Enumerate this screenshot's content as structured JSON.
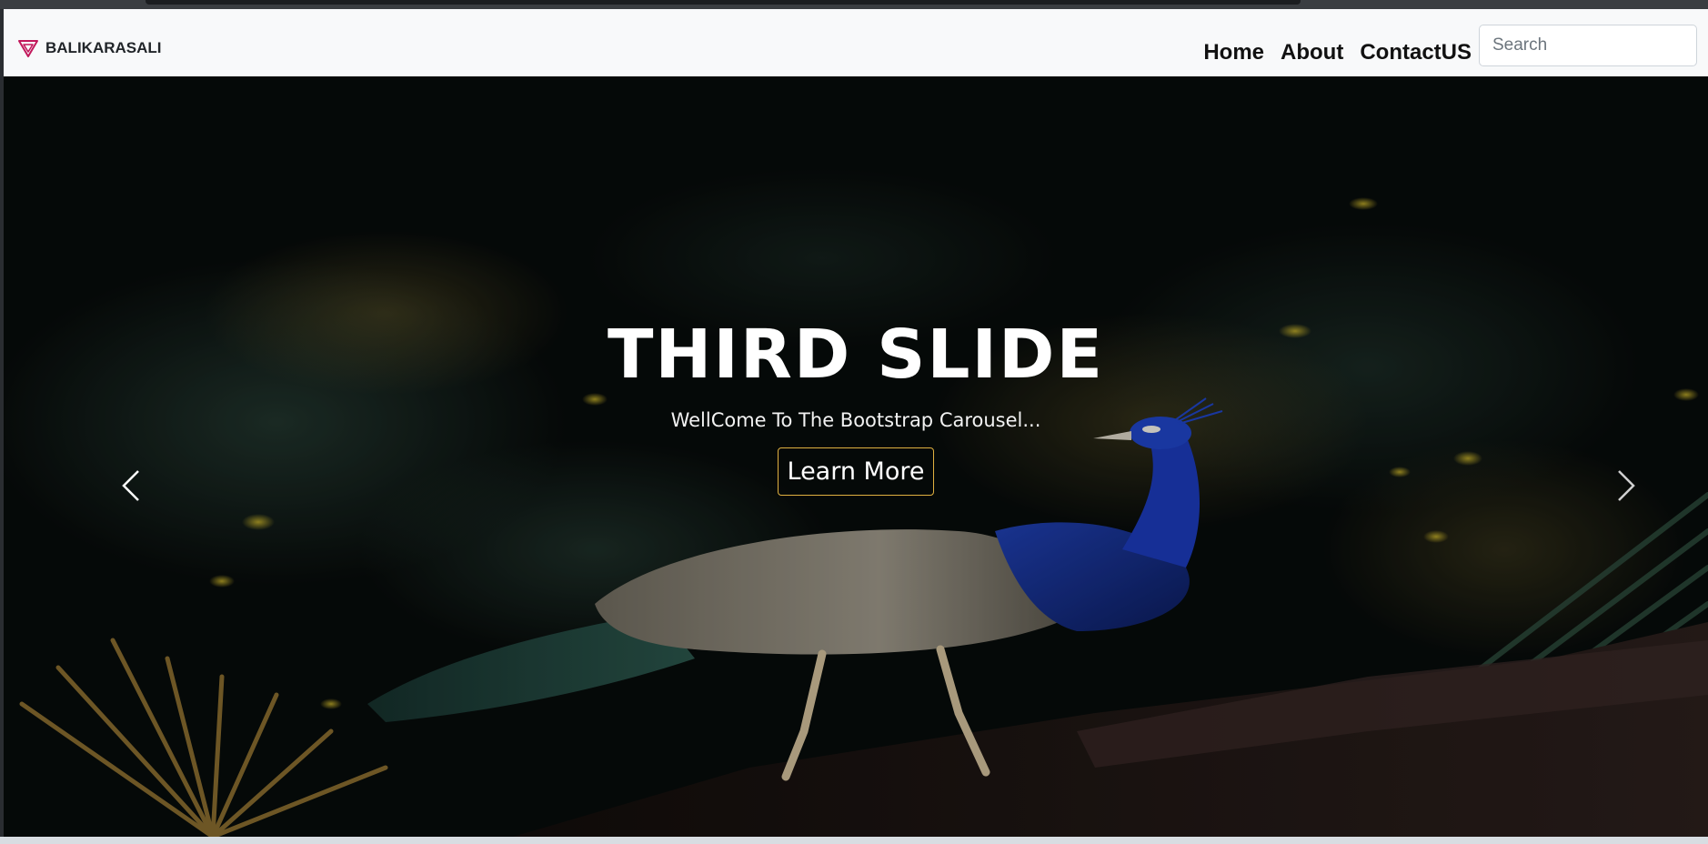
{
  "brand": {
    "name": "BALIKARASALI",
    "logo_icon": "triangle-logo-icon",
    "logo_color": "#c2185b"
  },
  "nav": {
    "items": [
      {
        "label": "Home"
      },
      {
        "label": "About"
      },
      {
        "label": "ContactUS"
      }
    ],
    "search": {
      "placeholder": "Search",
      "value": ""
    }
  },
  "carousel": {
    "slide_title": "THIRD SLIDE",
    "slide_text": "WellCome To The Bootstrap Carousel...",
    "button_label": "Learn More",
    "button_border_color": "#e0b040",
    "prev_icon": "chevron-left-icon",
    "next_icon": "chevron-right-icon"
  }
}
